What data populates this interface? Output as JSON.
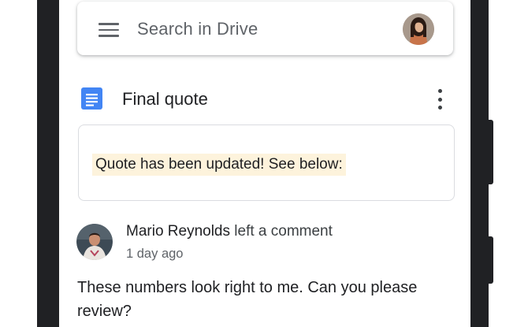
{
  "search": {
    "placeholder": "Search in Drive"
  },
  "document": {
    "title": "Final quote",
    "icon": "google-docs-icon"
  },
  "quote": {
    "text": "Quote has been updated! See below:"
  },
  "comment": {
    "author": "Mario Reynolds",
    "action": "left a comment",
    "time": "1 day ago",
    "body": "These numbers look right to me. Can you please review?"
  },
  "colors": {
    "docs_blue": "#4285f4",
    "highlight": "#fdf3dc",
    "phone_frame": "#202124"
  }
}
